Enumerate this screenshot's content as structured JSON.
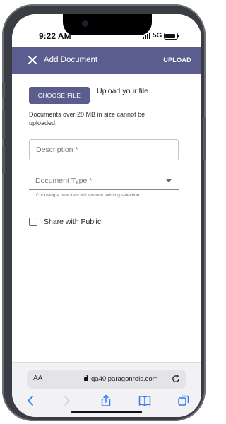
{
  "status_bar": {
    "time": "9:22 AM",
    "network": "5G",
    "battery_level": 0.85
  },
  "app_bar": {
    "title": "Add Document",
    "action": "UPLOAD",
    "close_icon": "close-icon"
  },
  "form": {
    "choose_file_label": "CHOOSE FILE",
    "upload_placeholder": "Upload your file",
    "size_note": "Documents over 20 MB in size cannot be uploaded.",
    "description_label": "Description *",
    "document_type_label": "Document Type *",
    "document_type_helper": "Choosing a new item will remove existing selection",
    "share_label": "Share with Public",
    "share_checked": false
  },
  "browser": {
    "text_size_label": "AA",
    "url": "qa40.paragonrels.com",
    "icons": [
      "lock-icon",
      "reload-icon",
      "back-icon",
      "forward-icon",
      "share-icon",
      "bookmarks-icon",
      "tabs-icon"
    ]
  },
  "colors": {
    "accent": "#5b5d8f",
    "frame": "#3a3d44"
  }
}
